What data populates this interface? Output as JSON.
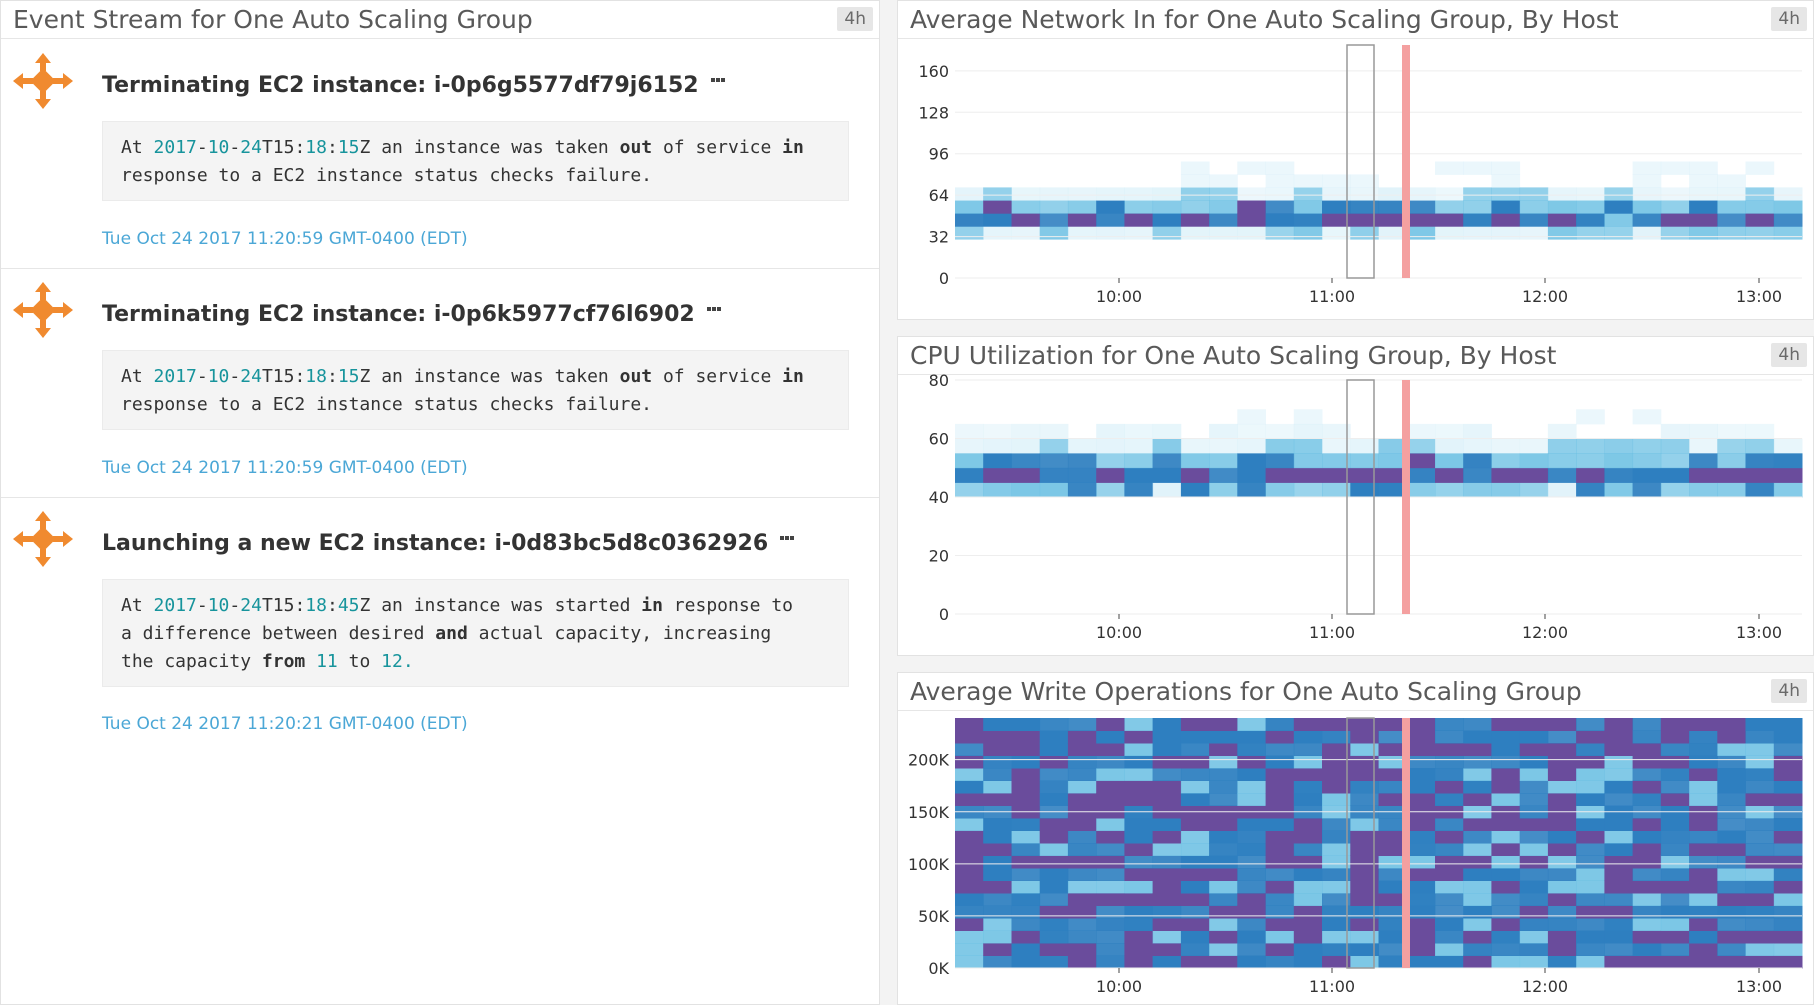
{
  "event_stream": {
    "title": "Event Stream for One Auto Scaling Group",
    "badge": "4h",
    "events": [
      {
        "icon": "autoscaling-icon",
        "title": "Terminating EC2 instance: i-0p6g5577df79j6152",
        "body_parts": [
          [
            "t",
            "At "
          ],
          [
            "n",
            "2017"
          ],
          [
            "t",
            "-"
          ],
          [
            "n",
            "10"
          ],
          [
            "t",
            "-"
          ],
          [
            "n",
            "24"
          ],
          [
            "t",
            "T15:"
          ],
          [
            "n",
            "18"
          ],
          [
            "t",
            ":"
          ],
          [
            "n",
            "15"
          ],
          [
            "t",
            "Z an instance was taken "
          ],
          [
            "k",
            "out"
          ],
          [
            "t",
            " of service "
          ],
          [
            "k",
            "in"
          ],
          [
            "t",
            "\nresponse to a EC2 instance status checks failure."
          ]
        ],
        "date": "Tue Oct 24 2017 11:20:59 GMT-0400 (EDT)"
      },
      {
        "icon": "autoscaling-icon",
        "title": "Terminating EC2 instance: i-0p6k5977cf76l6902",
        "body_parts": [
          [
            "t",
            "At "
          ],
          [
            "n",
            "2017"
          ],
          [
            "t",
            "-"
          ],
          [
            "n",
            "10"
          ],
          [
            "t",
            "-"
          ],
          [
            "n",
            "24"
          ],
          [
            "t",
            "T15:"
          ],
          [
            "n",
            "18"
          ],
          [
            "t",
            ":"
          ],
          [
            "n",
            "15"
          ],
          [
            "t",
            "Z an instance was taken "
          ],
          [
            "k",
            "out"
          ],
          [
            "t",
            " of service "
          ],
          [
            "k",
            "in"
          ],
          [
            "t",
            "\nresponse to a EC2 instance status checks failure."
          ]
        ],
        "date": "Tue Oct 24 2017 11:20:59 GMT-0400 (EDT)"
      },
      {
        "icon": "autoscaling-icon",
        "title": "Launching a new EC2 instance: i-0d83bc5d8c0362926",
        "body_parts": [
          [
            "t",
            "At "
          ],
          [
            "n",
            "2017"
          ],
          [
            "t",
            "-"
          ],
          [
            "n",
            "10"
          ],
          [
            "t",
            "-"
          ],
          [
            "n",
            "24"
          ],
          [
            "t",
            "T15:"
          ],
          [
            "n",
            "18"
          ],
          [
            "t",
            ":"
          ],
          [
            "n",
            "45"
          ],
          [
            "t",
            "Z an instance was started "
          ],
          [
            "k",
            "in"
          ],
          [
            "t",
            " response to\na difference between desired "
          ],
          [
            "k",
            "and"
          ],
          [
            "t",
            " actual capacity, increasing\nthe capacity "
          ],
          [
            "k",
            "from"
          ],
          [
            "t",
            " "
          ],
          [
            "n",
            "11"
          ],
          [
            "t",
            " to "
          ],
          [
            "n",
            "12."
          ]
        ],
        "date": "Tue Oct 24 2017 11:20:21 GMT-0400 (EDT)"
      }
    ]
  },
  "chart_data": [
    {
      "type": "heatmap",
      "title": "Average Network In for One Auto Scaling Group, By Host",
      "badge": "4h",
      "y_ticks": [
        "0",
        "32",
        "64",
        "96",
        "128",
        "160"
      ],
      "ylim": [
        0,
        180
      ],
      "x_ticks": [
        "10:00",
        "11:00",
        "12:00",
        "13:00"
      ],
      "band": {
        "low": 32,
        "high": 72,
        "peak": 48,
        "scale": 1
      }
    },
    {
      "type": "heatmap",
      "title": "CPU Utilization for One Auto Scaling Group, By Host",
      "badge": "4h",
      "y_ticks": [
        "0",
        "20",
        "40",
        "60",
        "80"
      ],
      "ylim": [
        0,
        80
      ],
      "x_ticks": [
        "10:00",
        "11:00",
        "12:00",
        "13:00"
      ],
      "band": {
        "low": 38,
        "high": 64,
        "peak": 48,
        "scale": 1
      }
    },
    {
      "type": "heatmap",
      "title": "Average Write Operations for One Auto Scaling Group",
      "badge": "4h",
      "y_ticks": [
        "0K",
        "50K",
        "100K",
        "150K",
        "200K"
      ],
      "ylim": [
        0,
        240000
      ],
      "x_ticks": [
        "10:00",
        "11:00",
        "12:00",
        "13:00"
      ],
      "band": {
        "low": 0,
        "high": 25000,
        "peak": 2000,
        "scale": 1000
      }
    }
  ],
  "colors": {
    "heat_low": "#d4eef8",
    "heat_mid": "#6cc0e3",
    "heat_high": "#2e7fc0",
    "heat_peak": "#6a4c9c",
    "event_marker": "#f4a0a0",
    "icon_orange": "#f08a2f"
  }
}
